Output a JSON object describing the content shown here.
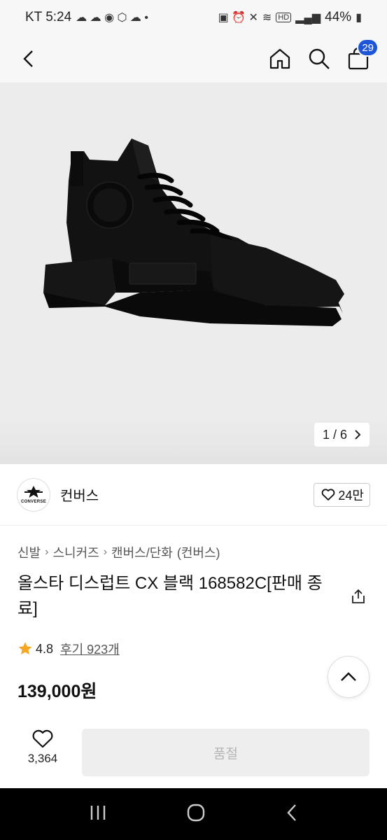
{
  "status_bar": {
    "carrier_time": "KT 5:24",
    "left_icons": [
      "●"
    ],
    "battery": "44%",
    "signal_label": "HD"
  },
  "header": {
    "back_icon": "chevron-left-icon",
    "home_icon": "home-icon",
    "search_icon": "search-icon",
    "cart_icon": "shopping-bag-icon",
    "cart_count": "29"
  },
  "gallery": {
    "counter": "1 / 6",
    "next_icon": "chevron-right-icon"
  },
  "brand": {
    "logo_text": "CONVERSE",
    "name": "컨버스",
    "like_count": "24만"
  },
  "breadcrumb": [
    "신발",
    "스니커즈",
    "캔버스/단화",
    "(컨버스)"
  ],
  "product": {
    "title": "올스타 디스럽트 CX 블랙 168582C[판매 종료]",
    "rating": "4.8",
    "reviews": "후기 923개",
    "price": "139,000원"
  },
  "bottom_bar": {
    "wish_count": "3,364",
    "soldout_label": "품절"
  },
  "colors": {
    "accent": "#1e55d6",
    "star": "#f5a623"
  }
}
